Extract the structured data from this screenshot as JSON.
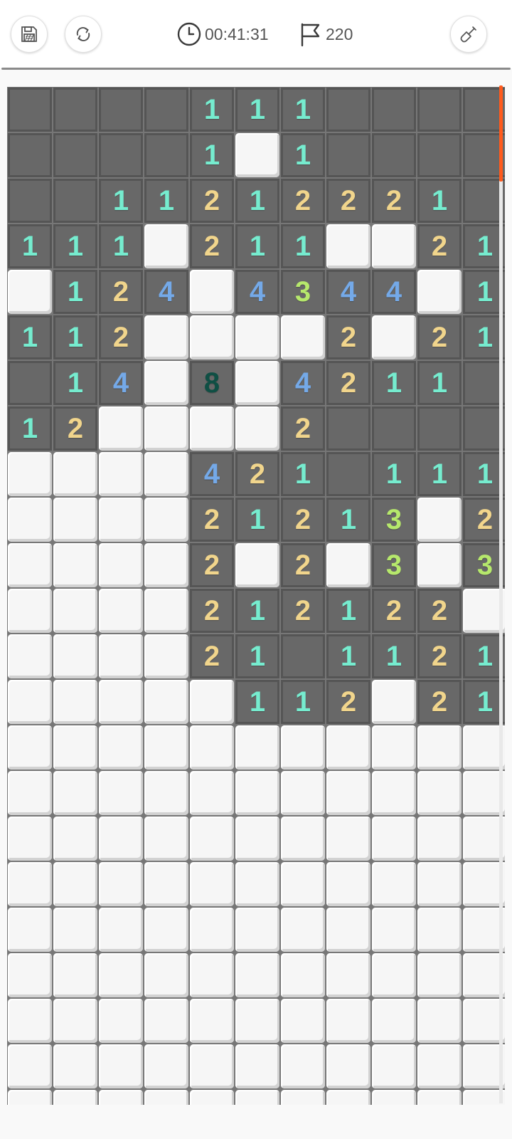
{
  "header": {
    "save_icon": "floppy-disk-icon",
    "restart_icon": "refresh-icon",
    "timer": {
      "icon": "clock-icon",
      "value": "00:41:31"
    },
    "flags": {
      "icon": "flag-icon",
      "value": "220"
    },
    "tool_icon": "shovel-icon"
  },
  "colors": {
    "1": "#76eccf",
    "2": "#f1d58c",
    "3": "#b6e86c",
    "4": "#74a9e8",
    "8": "#0f4f44",
    "revealed": "#686868",
    "hidden": "#f6f6f6",
    "scroll_accent": "#ff5a1c"
  },
  "board": {
    "columns": 11,
    "visible_rows": 23,
    "legend": "H = hidden tile, 0 = revealed empty, 1-8 = revealed number",
    "rows": [
      [
        "0",
        "0",
        "0",
        "0",
        "1",
        "1",
        "1",
        "0",
        "0",
        "0",
        "0"
      ],
      [
        "0",
        "0",
        "0",
        "0",
        "1",
        "H",
        "1",
        "0",
        "0",
        "0",
        "0"
      ],
      [
        "0",
        "0",
        "1",
        "1",
        "2",
        "1",
        "2",
        "2",
        "2",
        "1",
        "0"
      ],
      [
        "1",
        "1",
        "1",
        "H",
        "2",
        "1",
        "1",
        "H",
        "H",
        "2",
        "1"
      ],
      [
        "H",
        "1",
        "2",
        "4",
        "H",
        "4",
        "3",
        "4",
        "4",
        "H",
        "1"
      ],
      [
        "1",
        "1",
        "2",
        "H",
        "H",
        "H",
        "H",
        "2",
        "H",
        "2",
        "1"
      ],
      [
        "0",
        "1",
        "4",
        "H",
        "8",
        "H",
        "4",
        "2",
        "1",
        "1",
        "0"
      ],
      [
        "1",
        "2",
        "H",
        "H",
        "H",
        "H",
        "2",
        "0",
        "0",
        "0",
        "0"
      ],
      [
        "H",
        "H",
        "H",
        "H",
        "4",
        "2",
        "1",
        "0",
        "1",
        "1",
        "1"
      ],
      [
        "H",
        "H",
        "H",
        "H",
        "2",
        "1",
        "2",
        "1",
        "3",
        "H",
        "2"
      ],
      [
        "H",
        "H",
        "H",
        "H",
        "2",
        "H",
        "2",
        "H",
        "3",
        "H",
        "3"
      ],
      [
        "H",
        "H",
        "H",
        "H",
        "2",
        "1",
        "2",
        "1",
        "2",
        "2",
        "H"
      ],
      [
        "H",
        "H",
        "H",
        "H",
        "2",
        "1",
        "0",
        "1",
        "1",
        "2",
        "1"
      ],
      [
        "H",
        "H",
        "H",
        "H",
        "H",
        "1",
        "1",
        "2",
        "H",
        "2",
        "1"
      ],
      [
        "H",
        "H",
        "H",
        "H",
        "H",
        "H",
        "H",
        "H",
        "H",
        "H",
        "H"
      ],
      [
        "H",
        "H",
        "H",
        "H",
        "H",
        "H",
        "H",
        "H",
        "H",
        "H",
        "H"
      ],
      [
        "H",
        "H",
        "H",
        "H",
        "H",
        "H",
        "H",
        "H",
        "H",
        "H",
        "H"
      ],
      [
        "H",
        "H",
        "H",
        "H",
        "H",
        "H",
        "H",
        "H",
        "H",
        "H",
        "H"
      ],
      [
        "H",
        "H",
        "H",
        "H",
        "H",
        "H",
        "H",
        "H",
        "H",
        "H",
        "H"
      ],
      [
        "H",
        "H",
        "H",
        "H",
        "H",
        "H",
        "H",
        "H",
        "H",
        "H",
        "H"
      ],
      [
        "H",
        "H",
        "H",
        "H",
        "H",
        "H",
        "H",
        "H",
        "H",
        "H",
        "H"
      ],
      [
        "H",
        "H",
        "H",
        "H",
        "H",
        "H",
        "H",
        "H",
        "H",
        "H",
        "H"
      ],
      [
        "H",
        "H",
        "H",
        "H",
        "H",
        "H",
        "H",
        "H",
        "H",
        "H",
        "H"
      ]
    ]
  }
}
